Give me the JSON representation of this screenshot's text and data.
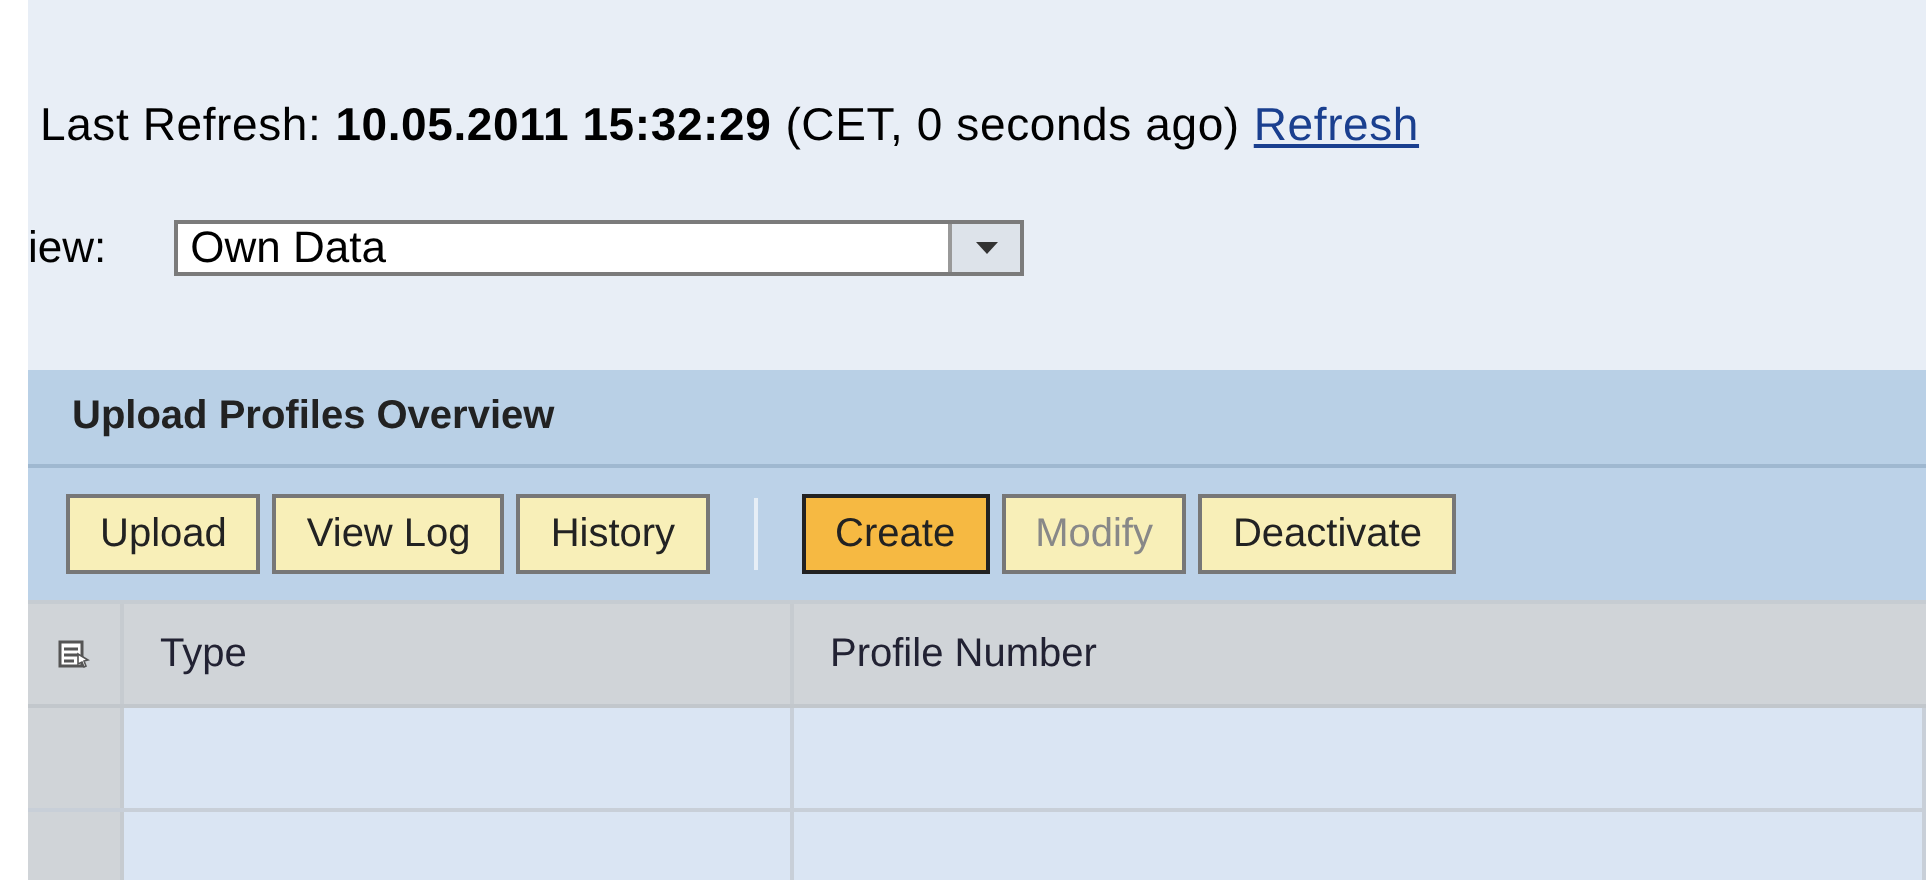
{
  "refresh": {
    "label": "Last Refresh:",
    "timestamp": "10.05.2011 15:32:29",
    "note": "(CET, 0 seconds ago)",
    "link": "Refresh"
  },
  "view": {
    "label": "iew:",
    "value": "Own Data"
  },
  "panel": {
    "title": "Upload Profiles Overview",
    "toolbar": [
      [
        {
          "label": "Upload",
          "emphasized": false,
          "disabled": false
        },
        {
          "label": "View Log",
          "emphasized": false,
          "disabled": false
        },
        {
          "label": "History",
          "emphasized": false,
          "disabled": false
        }
      ],
      [
        {
          "label": "Create",
          "emphasized": true,
          "disabled": false
        },
        {
          "label": "Modify",
          "emphasized": false,
          "disabled": true
        },
        {
          "label": "Deactivate",
          "emphasized": false,
          "disabled": false
        }
      ]
    ],
    "table": {
      "columns": [
        "Type",
        "Profile Number"
      ]
    }
  }
}
